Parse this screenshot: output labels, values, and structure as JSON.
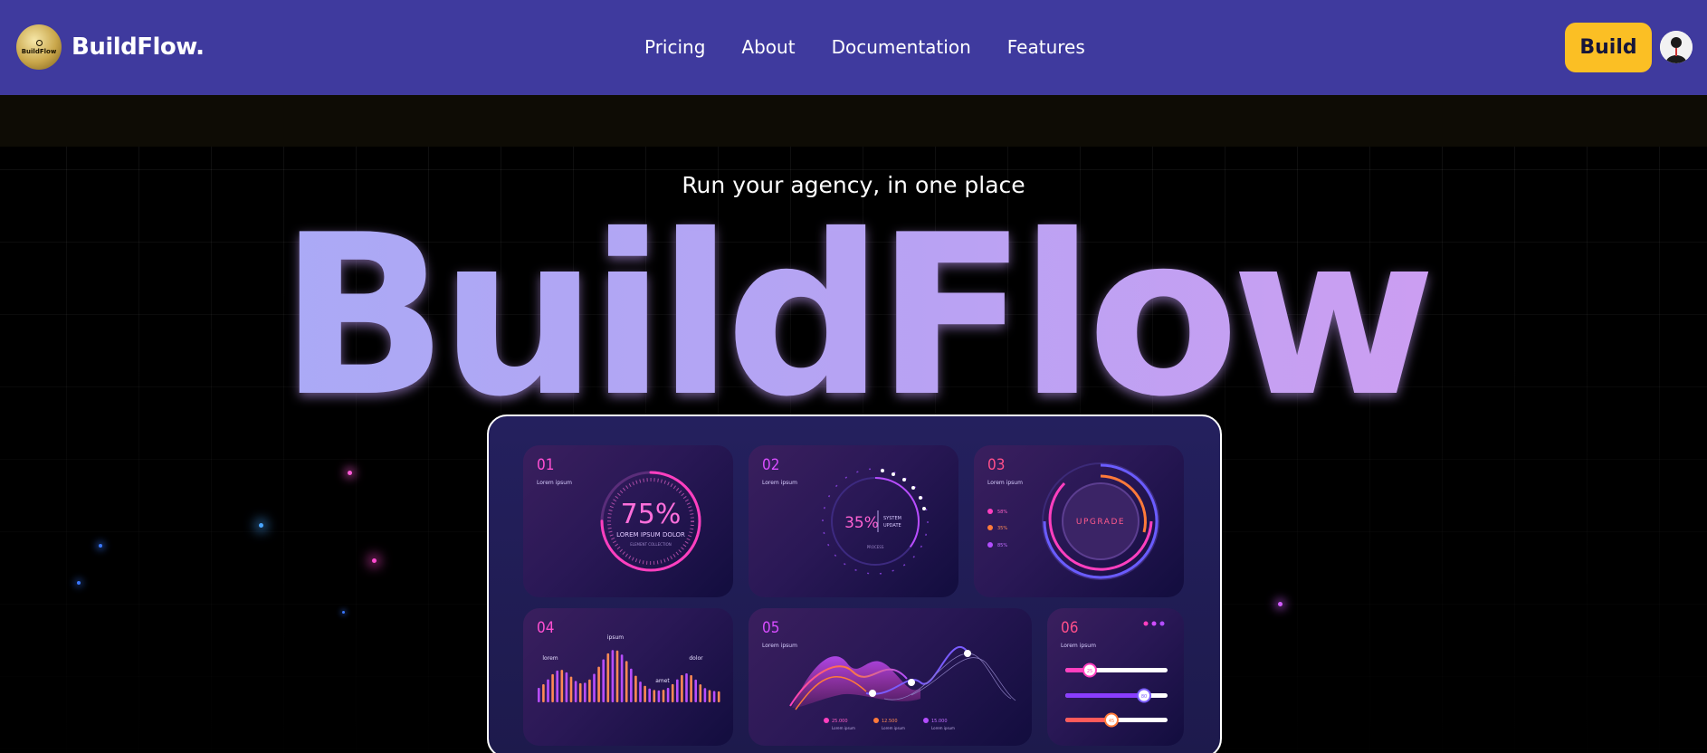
{
  "header": {
    "logo_text": "BuildFlow",
    "brand": "BuildFlow.",
    "nav": [
      "Pricing",
      "About",
      "Documentation",
      "Features"
    ],
    "build_button": "Build"
  },
  "hero": {
    "tagline": "Run your agency, in one place",
    "title": "BuildFlow"
  },
  "dashboard": {
    "card1": {
      "num": "01",
      "sub": "Lorem ipsum",
      "value": "75%",
      "caption": "LOREM IPSUM DOLOR",
      "small": "ELEMENT COLLECTION",
      "progress": 0.75
    },
    "card2": {
      "num": "02",
      "sub": "Lorem ipsum",
      "value": "35%",
      "line1": "SYSTEM",
      "line2": "UPDATE",
      "small": "PROCESS",
      "progress": 0.35
    },
    "card3": {
      "num": "03",
      "sub": "Lorem ipsum",
      "label": "UPGRADE",
      "legend": [
        "58%",
        "35%",
        "85%"
      ]
    },
    "card4": {
      "num": "04",
      "labels": [
        "lorem",
        "ipsum",
        "amet",
        "dolor"
      ]
    },
    "card5": {
      "num": "05",
      "sub": "Lorem ipsum",
      "stats": [
        "25.000",
        "12.500",
        "15.000"
      ],
      "stat_caption": "Lorem ipsum"
    },
    "card6": {
      "num": "06",
      "sub": "Lorem ipsum",
      "sliders": [
        "25",
        "80",
        "45"
      ]
    }
  },
  "colors": {
    "nav_bg": "#3f3a9e",
    "build_button": "#fbbf24",
    "title_gradient": [
      "#a5adf7",
      "#d69cf2"
    ],
    "accent_pink": "#ff3fbf",
    "accent_orange": "#ff7a3a",
    "accent_purple": "#b34dff"
  }
}
